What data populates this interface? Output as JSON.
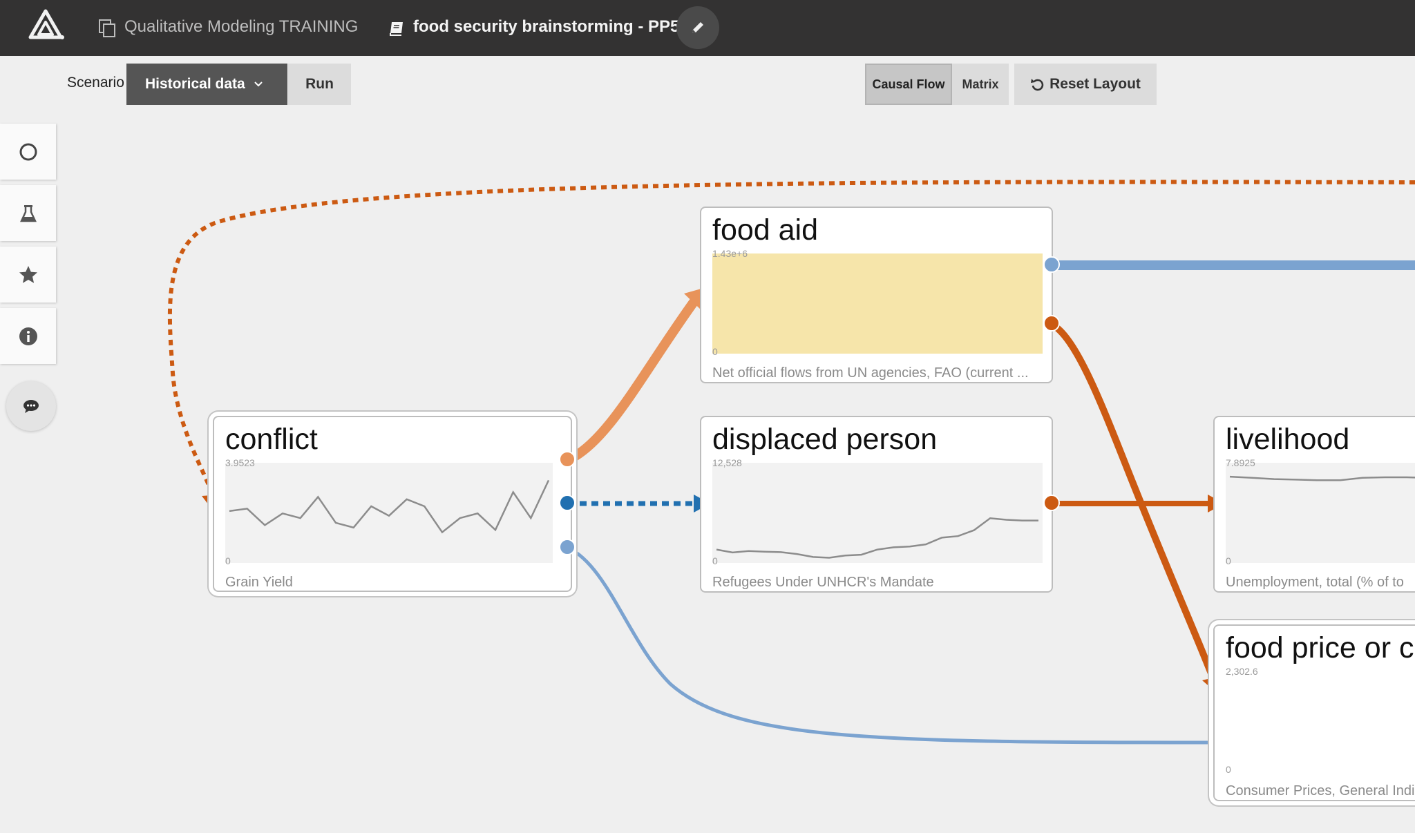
{
  "topbar": {
    "project_name": "Qualitative Modeling TRAINING",
    "model_name": "food security brainstorming - PP5",
    "icons": {
      "logo": "app-logo",
      "project": "copy-icon",
      "model": "book-icon",
      "edit": "pencil-icon"
    }
  },
  "toolbar": {
    "scenario_label": "Scenario",
    "scenario_value": "Historical data",
    "run_label": "Run",
    "view_causal_flow": "Causal Flow",
    "view_matrix": "Matrix",
    "reset_layout": "Reset Layout",
    "active_view": "Causal Flow"
  },
  "left_rail": {
    "items": [
      "circle-icon",
      "flask-icon",
      "star-icon",
      "info-icon",
      "chat-icon"
    ]
  },
  "nodes": {
    "conflict": {
      "title": "conflict",
      "ymax": "3.9523",
      "ymin": "0",
      "desc": "Grain Yield",
      "series": [
        2.2,
        2.3,
        1.6,
        2.1,
        1.9,
        2.8,
        1.7,
        1.5,
        2.4,
        2.0,
        2.7,
        2.4,
        1.3,
        1.9,
        2.1,
        1.4,
        3.0,
        1.9,
        3.5
      ]
    },
    "food_aid": {
      "title": "food aid",
      "ymax": "1.43e+6",
      "ymin": "0",
      "desc": "Net official flows from UN agencies, FAO (current ..."
    },
    "displaced_person": {
      "title": "displaced person",
      "ymax": "12,528",
      "ymin": "0",
      "desc": "Refugees Under UNHCR's Mandate",
      "series": [
        1800,
        1400,
        1600,
        1500,
        1450,
        1200,
        800,
        700,
        1000,
        1100,
        1800,
        2100,
        2200,
        2500,
        3400,
        3600,
        4400,
        6000,
        5800,
        5700,
        5700
      ]
    },
    "livelihood": {
      "title": "livelihood",
      "ymax": "7.8925",
      "ymin": "0",
      "desc": "Unemployment, total (% of to",
      "series": [
        7.3,
        7.2,
        7.1,
        7.05,
        7.0,
        7.0,
        7.2,
        7.25,
        7.25,
        7.2
      ]
    },
    "food_price": {
      "title": "food price or co",
      "ymax": "2,302.6",
      "ymin": "0",
      "desc": "Consumer Prices, General Indi"
    }
  },
  "colors": {
    "orange_dark": "#cc5a12",
    "orange_light": "#e8935a",
    "blue_dark": "#2170b0",
    "blue_light": "#7ba3d0"
  }
}
